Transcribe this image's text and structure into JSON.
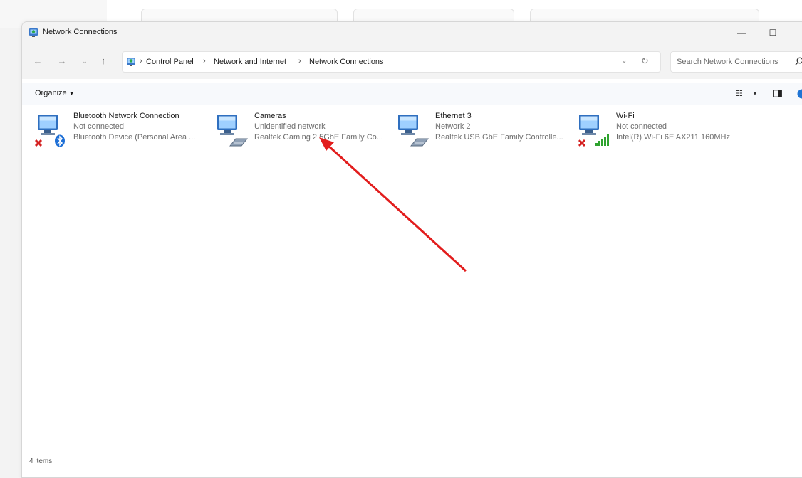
{
  "window": {
    "title": "Network Connections",
    "minimize": "—",
    "maximize": "☐"
  },
  "address": {
    "crumbs": [
      "Control Panel",
      "Network and Internet",
      "Network Connections"
    ],
    "search_placeholder": "Search Network Connections"
  },
  "toolbar": {
    "organize_label": "Organize"
  },
  "connections": [
    {
      "name": "Bluetooth Network Connection",
      "status": "Not connected",
      "device": "Bluetooth Device (Personal Area ...",
      "badge": "bluetooth-icon",
      "disconnected": true
    },
    {
      "name": "Cameras",
      "status": "Unidentified network",
      "device": "Realtek Gaming 2.5GbE Family Co...",
      "badge": "ethernet-cable-icon",
      "disconnected": false
    },
    {
      "name": "Ethernet 3",
      "status": "Network 2",
      "device": "Realtek USB GbE Family Controlle...",
      "badge": "ethernet-cable-icon",
      "disconnected": false
    },
    {
      "name": "Wi-Fi",
      "status": "Not connected",
      "device": "Intel(R) Wi-Fi 6E AX211 160MHz",
      "badge": "wifi-signal-icon",
      "disconnected": true
    }
  ],
  "footer": {
    "item_count": "4 items"
  },
  "colors": {
    "annotation_arrow": "#e21d1d",
    "disconnected_x": "#d42020",
    "bluetooth": "#1d6fd6",
    "wifi": "#2fa32f"
  }
}
